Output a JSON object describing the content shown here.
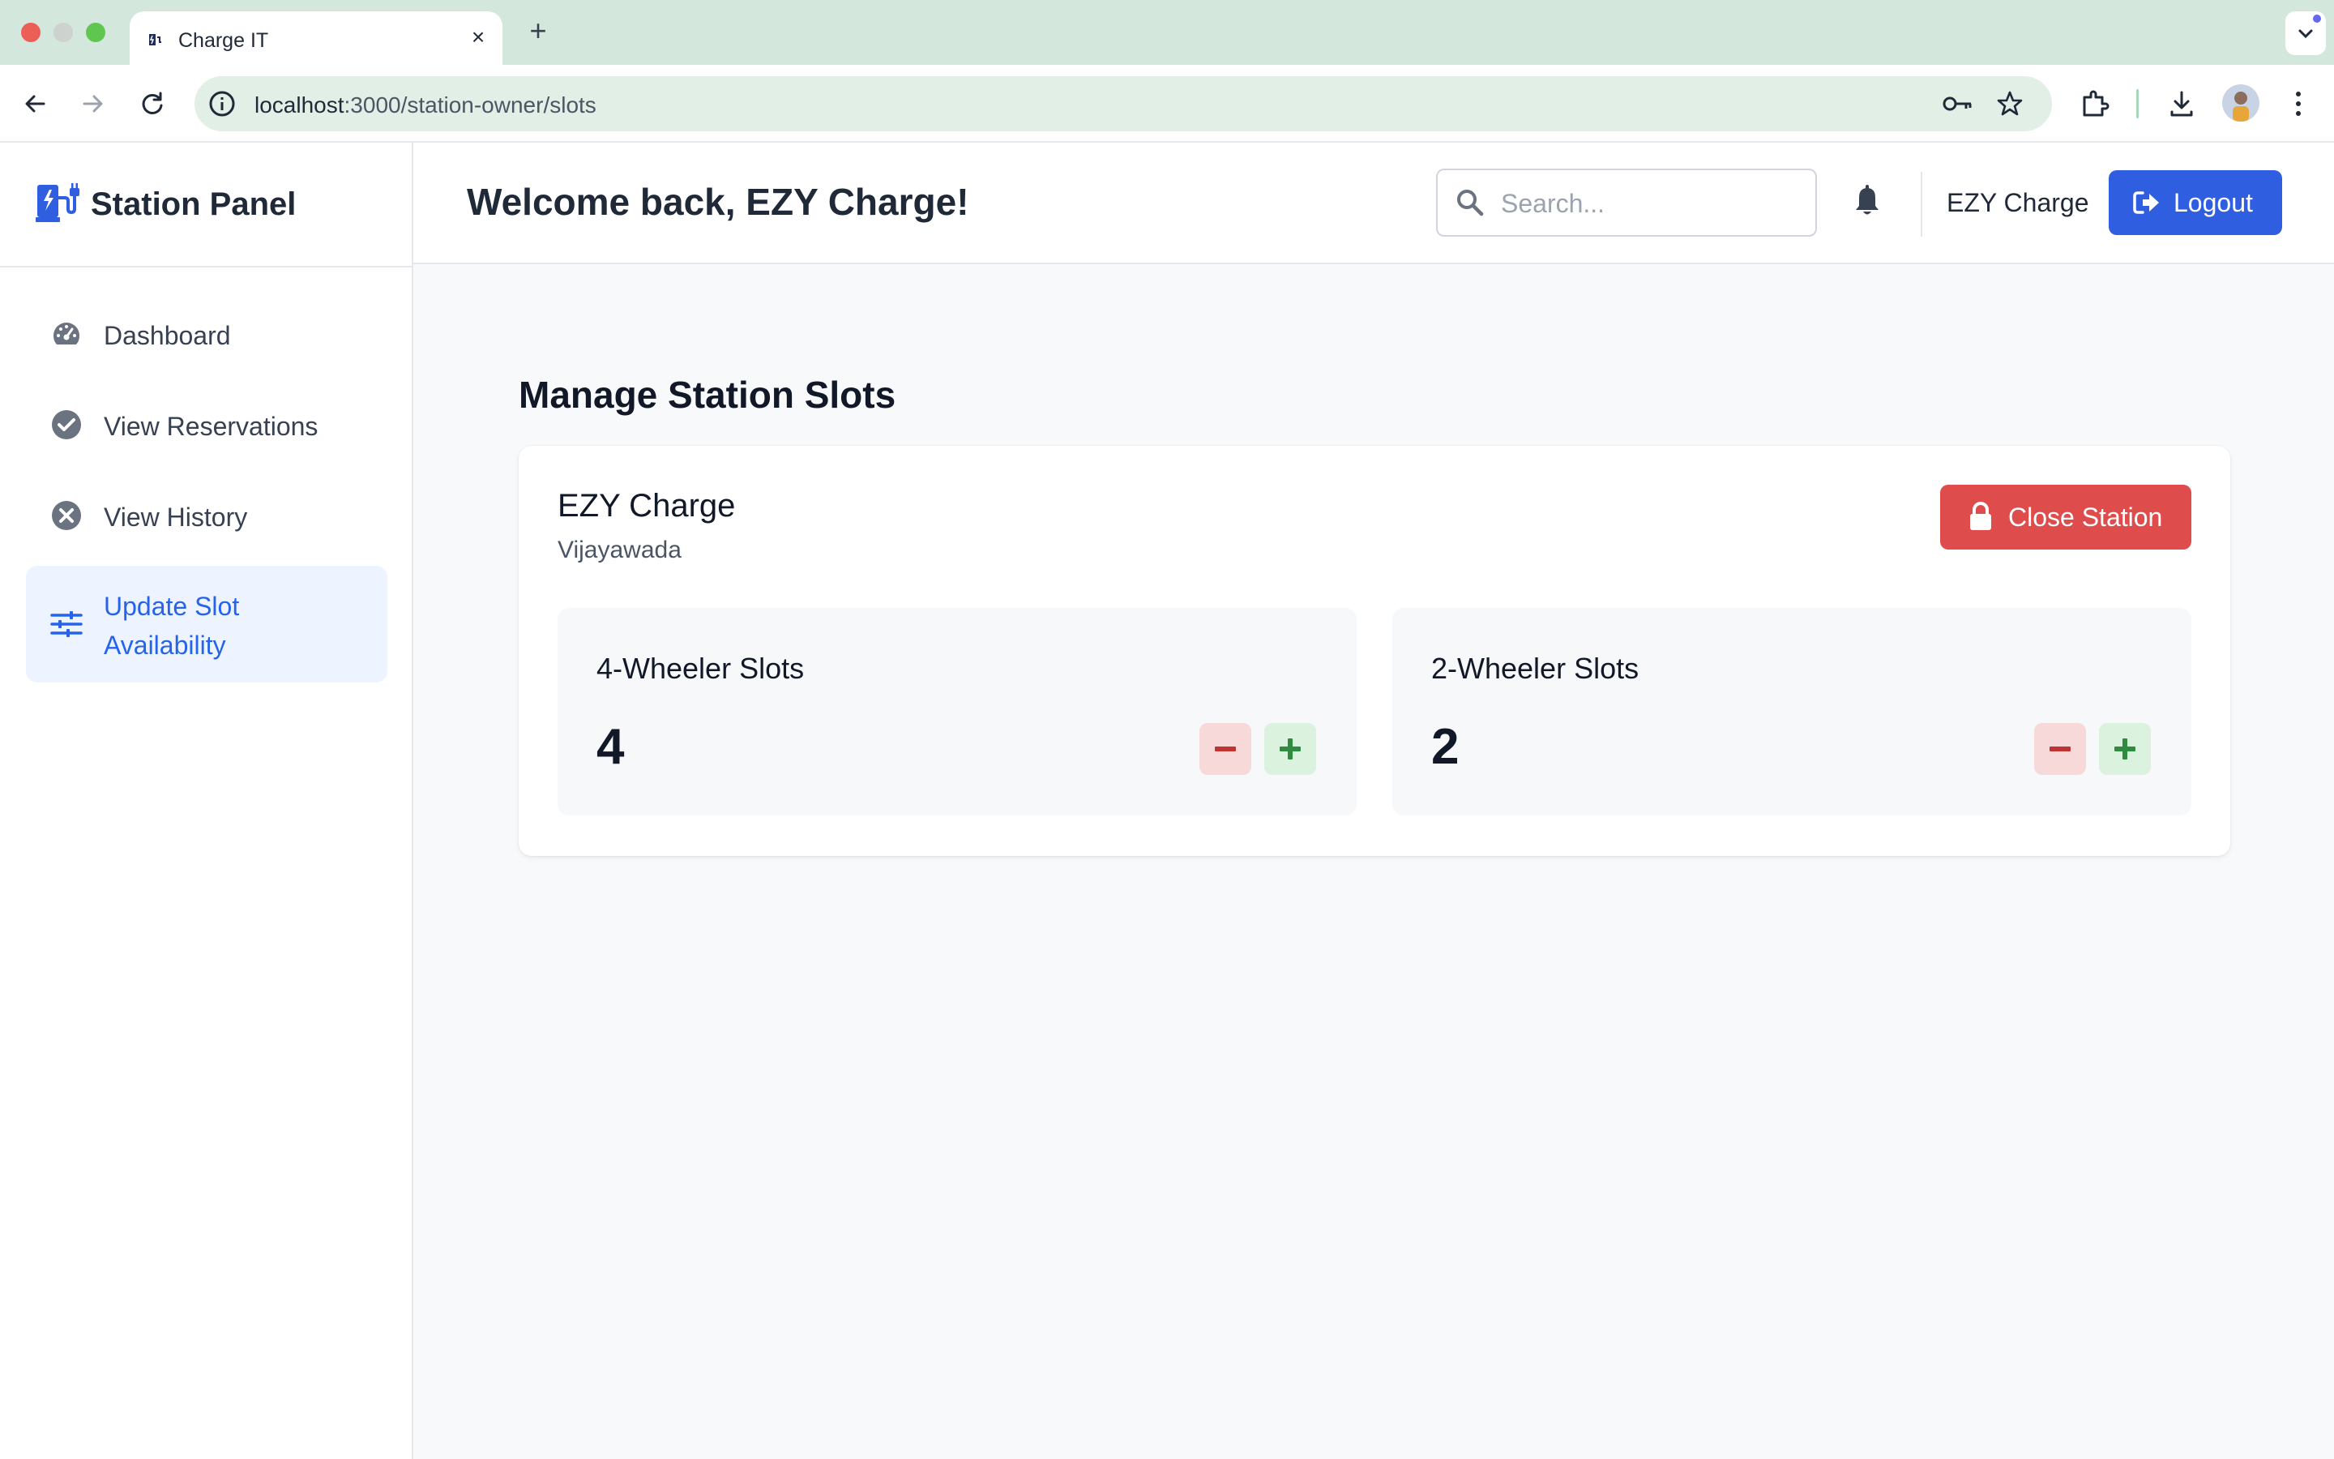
{
  "browser": {
    "tab_title": "Charge IT",
    "url_host": "localhost",
    "url_rest": ":3000/station-owner/slots"
  },
  "sidebar": {
    "title": "Station Panel",
    "items": [
      {
        "label": "Dashboard",
        "icon": "gauge-icon"
      },
      {
        "label": "View Reservations",
        "icon": "check-circle-icon"
      },
      {
        "label": "View History",
        "icon": "x-circle-icon"
      },
      {
        "label": "Update Slot Availability",
        "icon": "sliders-icon",
        "active": true
      }
    ]
  },
  "header": {
    "welcome": "Welcome back, EZY Charge!",
    "search_placeholder": "Search...",
    "user_name": "EZY Charge",
    "logout_label": "Logout"
  },
  "main": {
    "page_title": "Manage Station Slots",
    "station": {
      "name": "EZY Charge",
      "location": "Vijayawada",
      "close_label": "Close Station"
    },
    "slots": [
      {
        "label": "4-Wheeler Slots",
        "count": "4"
      },
      {
        "label": "2-Wheeler Slots",
        "count": "2"
      }
    ]
  },
  "colors": {
    "primary": "#2f5fe0",
    "danger": "#df4c4c",
    "active_bg": "#eef4ff",
    "active_text": "#2563eb"
  }
}
